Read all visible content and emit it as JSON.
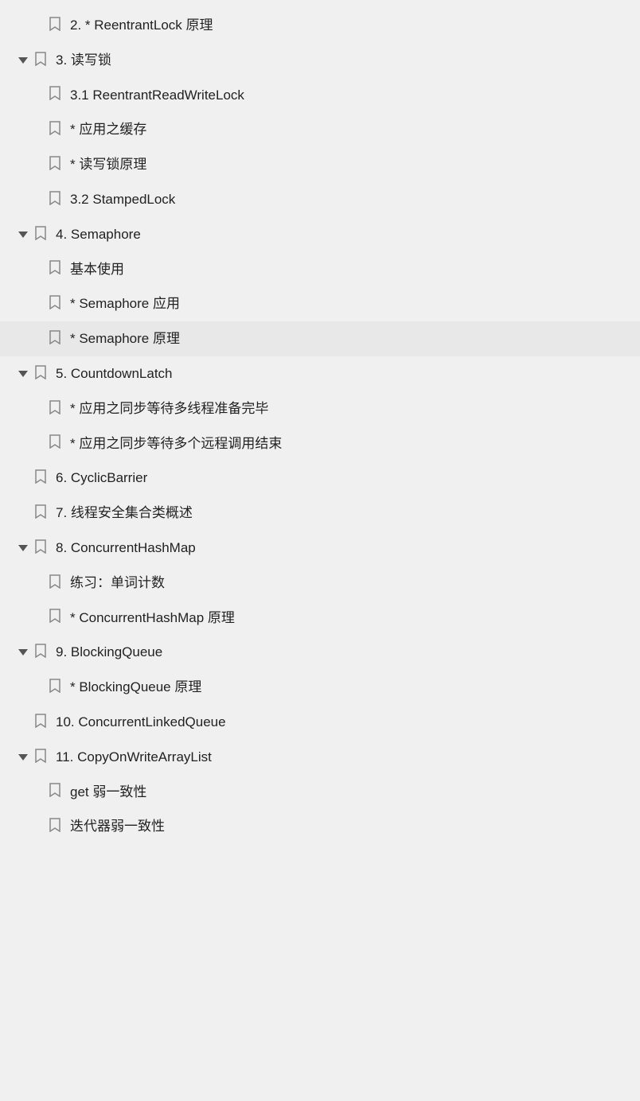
{
  "tree": {
    "items": [
      {
        "id": "item-reentrantlock-principle",
        "level": 2,
        "label": "2. * ReentrantLock 原理",
        "hasToggle": false,
        "toggleExpanded": false,
        "highlighted": false
      },
      {
        "id": "item-rw-lock",
        "level": 1,
        "label": "3. 读写锁",
        "hasToggle": true,
        "toggleExpanded": true,
        "highlighted": false
      },
      {
        "id": "item-reentrantreadwritelock",
        "level": 2,
        "label": "3.1 ReentrantReadWriteLock",
        "hasToggle": false,
        "toggleExpanded": false,
        "highlighted": false
      },
      {
        "id": "item-app-cache",
        "level": 2,
        "label": "* 应用之缓存",
        "hasToggle": false,
        "toggleExpanded": false,
        "highlighted": false
      },
      {
        "id": "item-rw-principle",
        "level": 2,
        "label": "* 读写锁原理",
        "hasToggle": false,
        "toggleExpanded": false,
        "highlighted": false
      },
      {
        "id": "item-stampedlock",
        "level": 2,
        "label": "3.2 StampedLock",
        "hasToggle": false,
        "toggleExpanded": false,
        "highlighted": false
      },
      {
        "id": "item-semaphore",
        "level": 1,
        "label": "4. Semaphore",
        "hasToggle": true,
        "toggleExpanded": true,
        "highlighted": false
      },
      {
        "id": "item-basic-use",
        "level": 2,
        "label": "基本使用",
        "hasToggle": false,
        "toggleExpanded": false,
        "highlighted": false
      },
      {
        "id": "item-semaphore-app",
        "level": 2,
        "label": "* Semaphore 应用",
        "hasToggle": false,
        "toggleExpanded": false,
        "highlighted": false
      },
      {
        "id": "item-semaphore-ee",
        "level": 2,
        "label": "* Semaphore 原理",
        "hasToggle": false,
        "toggleExpanded": false,
        "highlighted": true
      },
      {
        "id": "item-countdownlatch",
        "level": 1,
        "label": "5. CountdownLatch",
        "hasToggle": true,
        "toggleExpanded": true,
        "highlighted": false
      },
      {
        "id": "item-sync-multithread",
        "level": 2,
        "label": "* 应用之同步等待多线程准备完毕",
        "hasToggle": false,
        "toggleExpanded": false,
        "highlighted": false
      },
      {
        "id": "item-sync-remote",
        "level": 2,
        "label": "* 应用之同步等待多个远程调用结束",
        "hasToggle": false,
        "toggleExpanded": false,
        "highlighted": false
      },
      {
        "id": "item-cyclicbarrier",
        "level": 1,
        "label": "6. CyclicBarrier",
        "hasToggle": false,
        "toggleExpanded": false,
        "highlighted": false
      },
      {
        "id": "item-thread-safe-overview",
        "level": 1,
        "label": "7. 线程安全集合类概述",
        "hasToggle": false,
        "toggleExpanded": false,
        "highlighted": false
      },
      {
        "id": "item-concurrenthashmap",
        "level": 1,
        "label": "8. ConcurrentHashMap",
        "hasToggle": true,
        "toggleExpanded": true,
        "highlighted": false
      },
      {
        "id": "item-word-count",
        "level": 2,
        "label": "练习：单词计数",
        "hasToggle": false,
        "toggleExpanded": false,
        "highlighted": false
      },
      {
        "id": "item-chm-principle",
        "level": 2,
        "label": "* ConcurrentHashMap 原理",
        "hasToggle": false,
        "toggleExpanded": false,
        "highlighted": false
      },
      {
        "id": "item-blockingqueue",
        "level": 1,
        "label": "9. BlockingQueue",
        "hasToggle": true,
        "toggleExpanded": true,
        "highlighted": false
      },
      {
        "id": "item-bq-principle",
        "level": 2,
        "label": "* BlockingQueue 原理",
        "hasToggle": false,
        "toggleExpanded": false,
        "highlighted": false
      },
      {
        "id": "item-concurrentlinkedqueue",
        "level": 1,
        "label": "10. ConcurrentLinkedQueue",
        "hasToggle": false,
        "toggleExpanded": false,
        "highlighted": false
      },
      {
        "id": "item-copyonwritearraylist",
        "level": 1,
        "label": "11. CopyOnWriteArrayList",
        "hasToggle": true,
        "toggleExpanded": true,
        "highlighted": false
      },
      {
        "id": "item-get-weak",
        "level": 2,
        "label": "get 弱一致性",
        "hasToggle": false,
        "toggleExpanded": false,
        "highlighted": false
      },
      {
        "id": "item-iter-weak",
        "level": 2,
        "label": "迭代器弱一致性",
        "hasToggle": false,
        "toggleExpanded": false,
        "highlighted": false
      }
    ]
  }
}
